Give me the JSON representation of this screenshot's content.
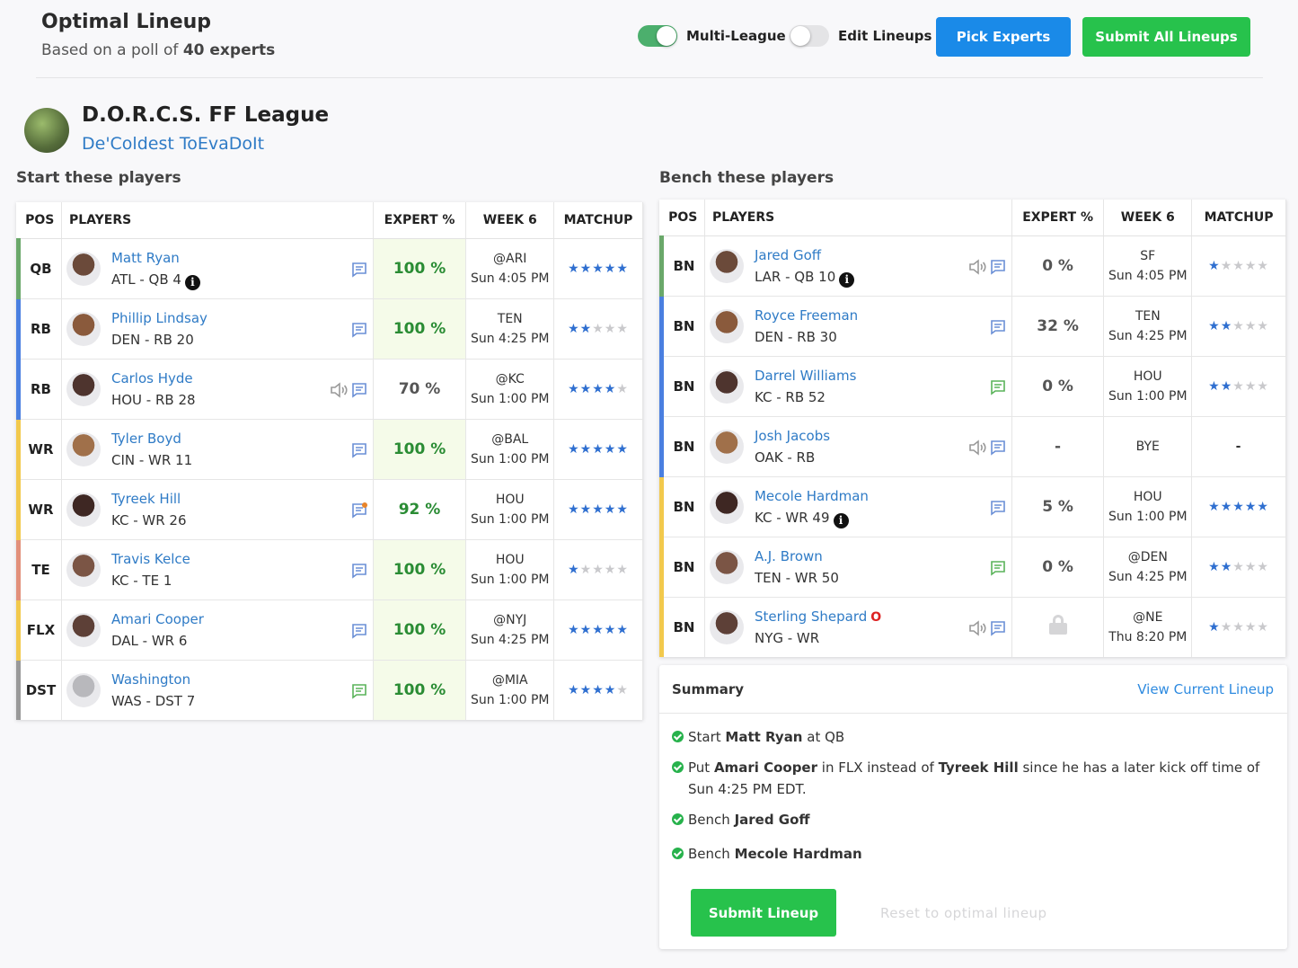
{
  "header": {
    "title": "Optimal Lineup",
    "subtitle_prefix": "Based on a poll of ",
    "subtitle_bold": "40 experts",
    "multi_league": {
      "label": "Multi-League",
      "on": true
    },
    "edit_lineups": {
      "label": "Edit Lineups",
      "on": false
    },
    "pick_experts": "Pick Experts",
    "submit_all": "Submit All Lineups"
  },
  "league": {
    "name": "D.O.R.C.S. FF League",
    "team": "De'Coldest ToEvaDoIt"
  },
  "start": {
    "title": "Start these players",
    "columns": [
      "POS",
      "PLAYERS",
      "EXPERT %",
      "WEEK 6",
      "MATCHUP"
    ],
    "rows": [
      {
        "pos": "QB",
        "pos_color": "#6aa86a",
        "name": "Matt Ryan",
        "team": "ATL - QB 4",
        "info": true,
        "note": "",
        "icons": [
          "comment-icon"
        ],
        "pct": "100 %",
        "pct_style": "full",
        "opp": "@ARI",
        "time": "Sun 4:05 PM",
        "stars": 5
      },
      {
        "pos": "RB",
        "pos_color": "#4a7fe0",
        "name": "Phillip Lindsay",
        "team": "DEN - RB 20",
        "info": false,
        "note": "",
        "icons": [
          "comment-icon"
        ],
        "pct": "100 %",
        "pct_style": "full",
        "opp": "TEN",
        "time": "Sun 4:25 PM",
        "stars": 2
      },
      {
        "pos": "RB",
        "pos_color": "#4a7fe0",
        "name": "Carlos Hyde",
        "team": "HOU - RB 28",
        "info": false,
        "note": "",
        "icons": [
          "audio-icon",
          "comment-icon"
        ],
        "pct": "70 %",
        "pct_style": "low",
        "opp": "@KC",
        "time": "Sun 1:00 PM",
        "stars": 4
      },
      {
        "pos": "WR",
        "pos_color": "#f2c94c",
        "name": "Tyler Boyd",
        "team": "CIN - WR 11",
        "info": false,
        "note": "",
        "icons": [
          "comment-icon"
        ],
        "pct": "100 %",
        "pct_style": "full",
        "opp": "@BAL",
        "time": "Sun 1:00 PM",
        "stars": 5
      },
      {
        "pos": "WR",
        "pos_color": "#f2c94c",
        "name": "Tyreek Hill",
        "team": "KC - WR 26",
        "info": false,
        "note": "",
        "icons": [
          "comment-alert-icon"
        ],
        "pct": "92 %",
        "pct_style": "mid",
        "opp": "HOU",
        "time": "Sun 1:00 PM",
        "stars": 5
      },
      {
        "pos": "TE",
        "pos_color": "#e2907a",
        "name": "Travis Kelce",
        "team": "KC - TE 1",
        "info": false,
        "note": "",
        "icons": [
          "comment-icon"
        ],
        "pct": "100 %",
        "pct_style": "full",
        "opp": "HOU",
        "time": "Sun 1:00 PM",
        "stars": 1
      },
      {
        "pos": "FLX",
        "pos_color": "#f2c94c",
        "name": "Amari Cooper",
        "team": "DAL - WR 6",
        "info": false,
        "note": "",
        "icons": [
          "comment-icon"
        ],
        "pct": "100 %",
        "pct_style": "full",
        "opp": "@NYJ",
        "time": "Sun 4:25 PM",
        "stars": 5
      },
      {
        "pos": "DST",
        "pos_color": "#999999",
        "name": "Washington",
        "team": "WAS - DST 7",
        "info": false,
        "note": "",
        "icons": [
          "comment-green-icon"
        ],
        "pct": "100 %",
        "pct_style": "full",
        "opp": "@MIA",
        "time": "Sun 1:00 PM",
        "stars": 4
      }
    ]
  },
  "bench": {
    "title": "Bench these players",
    "columns": [
      "POS",
      "PLAYERS",
      "EXPERT %",
      "WEEK 6",
      "MATCHUP"
    ],
    "rows": [
      {
        "pos": "BN",
        "pos_color": "#6aa86a",
        "name": "Jared Goff",
        "team": "LAR - QB 10",
        "info": true,
        "note": "",
        "icons": [
          "audio-icon",
          "comment-icon"
        ],
        "pct": "0 %",
        "pct_style": "low",
        "opp": "SF",
        "time": "Sun 4:05 PM",
        "stars": 1,
        "bye": false,
        "lock": false
      },
      {
        "pos": "BN",
        "pos_color": "#4a7fe0",
        "name": "Royce Freeman",
        "team": "DEN - RB 30",
        "info": false,
        "note": "",
        "icons": [
          "comment-icon"
        ],
        "pct": "32 %",
        "pct_style": "low",
        "opp": "TEN",
        "time": "Sun 4:25 PM",
        "stars": 2,
        "bye": false,
        "lock": false
      },
      {
        "pos": "BN",
        "pos_color": "#4a7fe0",
        "name": "Darrel Williams",
        "team": "KC - RB 52",
        "info": false,
        "note": "",
        "icons": [
          "comment-green-icon"
        ],
        "pct": "0 %",
        "pct_style": "low",
        "opp": "HOU",
        "time": "Sun 1:00 PM",
        "stars": 2,
        "bye": false,
        "lock": false
      },
      {
        "pos": "BN",
        "pos_color": "#4a7fe0",
        "name": "Josh Jacobs",
        "team": "OAK - RB",
        "info": false,
        "note": "",
        "icons": [
          "audio-icon",
          "comment-icon"
        ],
        "pct": "-",
        "pct_style": "low",
        "opp": "BYE",
        "time": "",
        "stars": 0,
        "bye": true,
        "bye_matchup": "-",
        "lock": false
      },
      {
        "pos": "BN",
        "pos_color": "#f2c94c",
        "name": "Mecole Hardman",
        "team": "KC - WR 49",
        "info": true,
        "note": "",
        "icons": [
          "comment-icon"
        ],
        "pct": "5 %",
        "pct_style": "low",
        "opp": "HOU",
        "time": "Sun 1:00 PM",
        "stars": 5,
        "bye": false,
        "lock": false
      },
      {
        "pos": "BN",
        "pos_color": "#f2c94c",
        "name": "A.J. Brown",
        "team": "TEN - WR 50",
        "info": false,
        "note": "",
        "icons": [
          "comment-green-icon"
        ],
        "pct": "0 %",
        "pct_style": "low",
        "opp": "@DEN",
        "time": "Sun 4:25 PM",
        "stars": 2,
        "bye": false,
        "lock": false
      },
      {
        "pos": "BN",
        "pos_color": "#f2c94c",
        "name": "Sterling Shepard",
        "team": "NYG - WR",
        "info": false,
        "note": "O",
        "icons": [
          "audio-icon",
          "comment-icon"
        ],
        "pct": "",
        "pct_style": "low",
        "opp": "@NE",
        "time": "Thu 8:20 PM",
        "stars": 1,
        "bye": false,
        "lock": true
      }
    ]
  },
  "summary": {
    "title": "Summary",
    "view_current": "View Current Lineup",
    "items": [
      [
        {
          "t": "Start "
        },
        {
          "t": "Matt Ryan",
          "b": true
        },
        {
          "t": " at QB"
        }
      ],
      [
        {
          "t": "Put "
        },
        {
          "t": "Amari Cooper",
          "b": true
        },
        {
          "t": " in FLX instead of "
        },
        {
          "t": "Tyreek Hill",
          "b": true
        },
        {
          "t": " since he has a later kick off time of Sun 4:25 PM EDT."
        }
      ],
      [
        {
          "t": "Bench "
        },
        {
          "t": "Jared Goff",
          "b": true
        }
      ],
      [
        {
          "t": "Bench "
        },
        {
          "t": "Mecole Hardman",
          "b": true
        }
      ]
    ],
    "submit": "Submit Lineup",
    "reset": "Reset to optimal lineup"
  },
  "colors": {
    "blue": "#1a8ae8",
    "green": "#27c24c",
    "link": "#2f7bc6",
    "star": "#2f6fd0"
  }
}
